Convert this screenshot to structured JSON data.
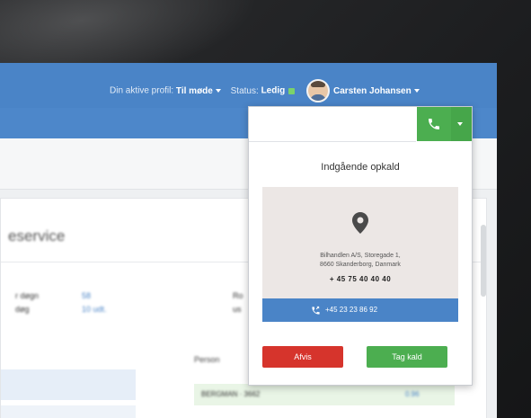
{
  "header": {
    "profile_label": "Din aktive profil:",
    "profile_value": "Til møde",
    "status_label": "Status:",
    "status_value": "Ledig",
    "user_name": "Carsten Johansen"
  },
  "page": {
    "title_fragment": "eservice",
    "meta": [
      {
        "label": "r døgn",
        "value": "58"
      },
      {
        "label": "døg",
        "value": "10 udt."
      }
    ],
    "right_col": [
      "Ro",
      "us"
    ],
    "section_label": "Person",
    "row_text": "BERGMAN · 3662",
    "row_value": "0.96"
  },
  "popup": {
    "heading": "Indgående opkald",
    "address_line1": "Bilhandlen A/S, Storegade 1,",
    "address_line2": "8660 Skanderborg, Danmark",
    "phone": "+ 45 75 40 40 40",
    "caller_number": "+45 23 23 86 92",
    "reject_label": "Afvis",
    "accept_label": "Tag kald"
  },
  "colors": {
    "header_blue": "#4a84c7",
    "accept_green": "#4cae50",
    "reject_red": "#d6342c",
    "status_green": "#7bd26a"
  },
  "icons": {
    "phone": "phone-icon",
    "location": "map-pin-icon",
    "call_forward": "phone-forward-icon"
  }
}
